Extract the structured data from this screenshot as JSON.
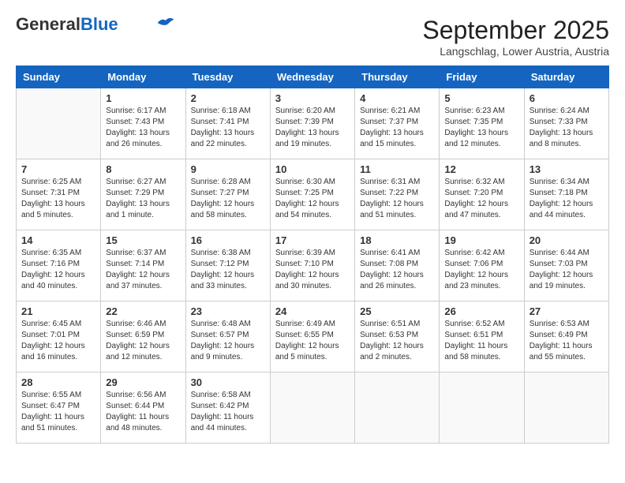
{
  "header": {
    "logo_line1": "General",
    "logo_line2": "Blue",
    "month": "September 2025",
    "location": "Langschlag, Lower Austria, Austria"
  },
  "weekdays": [
    "Sunday",
    "Monday",
    "Tuesday",
    "Wednesday",
    "Thursday",
    "Friday",
    "Saturday"
  ],
  "weeks": [
    [
      {
        "day": "",
        "info": ""
      },
      {
        "day": "1",
        "info": "Sunrise: 6:17 AM\nSunset: 7:43 PM\nDaylight: 13 hours\nand 26 minutes."
      },
      {
        "day": "2",
        "info": "Sunrise: 6:18 AM\nSunset: 7:41 PM\nDaylight: 13 hours\nand 22 minutes."
      },
      {
        "day": "3",
        "info": "Sunrise: 6:20 AM\nSunset: 7:39 PM\nDaylight: 13 hours\nand 19 minutes."
      },
      {
        "day": "4",
        "info": "Sunrise: 6:21 AM\nSunset: 7:37 PM\nDaylight: 13 hours\nand 15 minutes."
      },
      {
        "day": "5",
        "info": "Sunrise: 6:23 AM\nSunset: 7:35 PM\nDaylight: 13 hours\nand 12 minutes."
      },
      {
        "day": "6",
        "info": "Sunrise: 6:24 AM\nSunset: 7:33 PM\nDaylight: 13 hours\nand 8 minutes."
      }
    ],
    [
      {
        "day": "7",
        "info": "Sunrise: 6:25 AM\nSunset: 7:31 PM\nDaylight: 13 hours\nand 5 minutes."
      },
      {
        "day": "8",
        "info": "Sunrise: 6:27 AM\nSunset: 7:29 PM\nDaylight: 13 hours\nand 1 minute."
      },
      {
        "day": "9",
        "info": "Sunrise: 6:28 AM\nSunset: 7:27 PM\nDaylight: 12 hours\nand 58 minutes."
      },
      {
        "day": "10",
        "info": "Sunrise: 6:30 AM\nSunset: 7:25 PM\nDaylight: 12 hours\nand 54 minutes."
      },
      {
        "day": "11",
        "info": "Sunrise: 6:31 AM\nSunset: 7:22 PM\nDaylight: 12 hours\nand 51 minutes."
      },
      {
        "day": "12",
        "info": "Sunrise: 6:32 AM\nSunset: 7:20 PM\nDaylight: 12 hours\nand 47 minutes."
      },
      {
        "day": "13",
        "info": "Sunrise: 6:34 AM\nSunset: 7:18 PM\nDaylight: 12 hours\nand 44 minutes."
      }
    ],
    [
      {
        "day": "14",
        "info": "Sunrise: 6:35 AM\nSunset: 7:16 PM\nDaylight: 12 hours\nand 40 minutes."
      },
      {
        "day": "15",
        "info": "Sunrise: 6:37 AM\nSunset: 7:14 PM\nDaylight: 12 hours\nand 37 minutes."
      },
      {
        "day": "16",
        "info": "Sunrise: 6:38 AM\nSunset: 7:12 PM\nDaylight: 12 hours\nand 33 minutes."
      },
      {
        "day": "17",
        "info": "Sunrise: 6:39 AM\nSunset: 7:10 PM\nDaylight: 12 hours\nand 30 minutes."
      },
      {
        "day": "18",
        "info": "Sunrise: 6:41 AM\nSunset: 7:08 PM\nDaylight: 12 hours\nand 26 minutes."
      },
      {
        "day": "19",
        "info": "Sunrise: 6:42 AM\nSunset: 7:06 PM\nDaylight: 12 hours\nand 23 minutes."
      },
      {
        "day": "20",
        "info": "Sunrise: 6:44 AM\nSunset: 7:03 PM\nDaylight: 12 hours\nand 19 minutes."
      }
    ],
    [
      {
        "day": "21",
        "info": "Sunrise: 6:45 AM\nSunset: 7:01 PM\nDaylight: 12 hours\nand 16 minutes."
      },
      {
        "day": "22",
        "info": "Sunrise: 6:46 AM\nSunset: 6:59 PM\nDaylight: 12 hours\nand 12 minutes."
      },
      {
        "day": "23",
        "info": "Sunrise: 6:48 AM\nSunset: 6:57 PM\nDaylight: 12 hours\nand 9 minutes."
      },
      {
        "day": "24",
        "info": "Sunrise: 6:49 AM\nSunset: 6:55 PM\nDaylight: 12 hours\nand 5 minutes."
      },
      {
        "day": "25",
        "info": "Sunrise: 6:51 AM\nSunset: 6:53 PM\nDaylight: 12 hours\nand 2 minutes."
      },
      {
        "day": "26",
        "info": "Sunrise: 6:52 AM\nSunset: 6:51 PM\nDaylight: 11 hours\nand 58 minutes."
      },
      {
        "day": "27",
        "info": "Sunrise: 6:53 AM\nSunset: 6:49 PM\nDaylight: 11 hours\nand 55 minutes."
      }
    ],
    [
      {
        "day": "28",
        "info": "Sunrise: 6:55 AM\nSunset: 6:47 PM\nDaylight: 11 hours\nand 51 minutes."
      },
      {
        "day": "29",
        "info": "Sunrise: 6:56 AM\nSunset: 6:44 PM\nDaylight: 11 hours\nand 48 minutes."
      },
      {
        "day": "30",
        "info": "Sunrise: 6:58 AM\nSunset: 6:42 PM\nDaylight: 11 hours\nand 44 minutes."
      },
      {
        "day": "",
        "info": ""
      },
      {
        "day": "",
        "info": ""
      },
      {
        "day": "",
        "info": ""
      },
      {
        "day": "",
        "info": ""
      }
    ]
  ]
}
